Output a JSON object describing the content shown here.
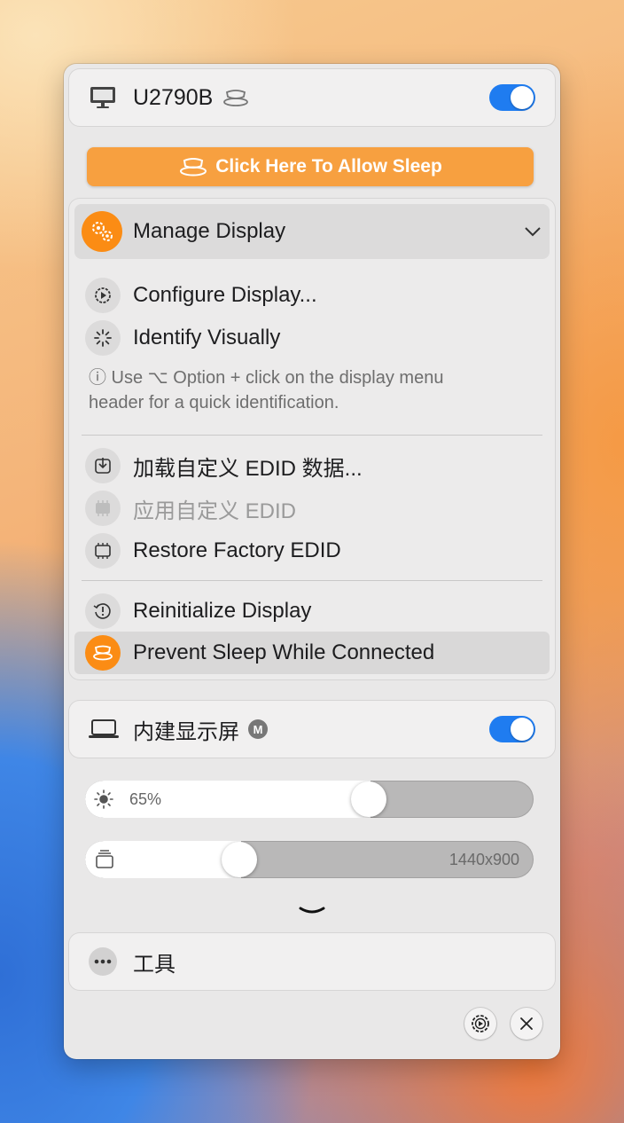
{
  "display1": {
    "name": "U2790B",
    "toggle_on": true,
    "allow_sleep_button": "Click Here To Allow Sleep",
    "manage_section": {
      "title": "Manage Display",
      "items": [
        {
          "label": "Configure Display...",
          "icon": "display-settings-icon",
          "enabled": true
        },
        {
          "label": "Identify Visually",
          "icon": "spinner-icon",
          "enabled": true
        }
      ],
      "info_line1": "ⓘ Use ⌥ Option + click on the display menu",
      "info_line2": "header for a quick identification.",
      "edid_items": [
        {
          "label": "加载自定义 EDID 数据...",
          "icon": "download-icon",
          "enabled": true
        },
        {
          "label": "应用自定义 EDID",
          "icon": "chip-icon",
          "enabled": false
        },
        {
          "label": "Restore Factory EDID",
          "icon": "chip-outline-icon",
          "enabled": true
        }
      ],
      "bottom_items": [
        {
          "label": "Reinitialize Display",
          "icon": "reset-icon",
          "enabled": true
        },
        {
          "label": "Prevent Sleep While Connected",
          "icon": "coffee-cup-icon",
          "enabled": true,
          "highlighted": true
        }
      ]
    }
  },
  "display2": {
    "name": "内建显示屏",
    "badge": "M",
    "toggle_on": true,
    "brightness": {
      "value_label": "65%",
      "level": 0.65
    },
    "resolution": {
      "value_label": "1440x900",
      "level": 0.35
    }
  },
  "tools": {
    "label": "工具"
  },
  "colors": {
    "accent": "#1f7cf0",
    "orange": "#fb8c14"
  }
}
